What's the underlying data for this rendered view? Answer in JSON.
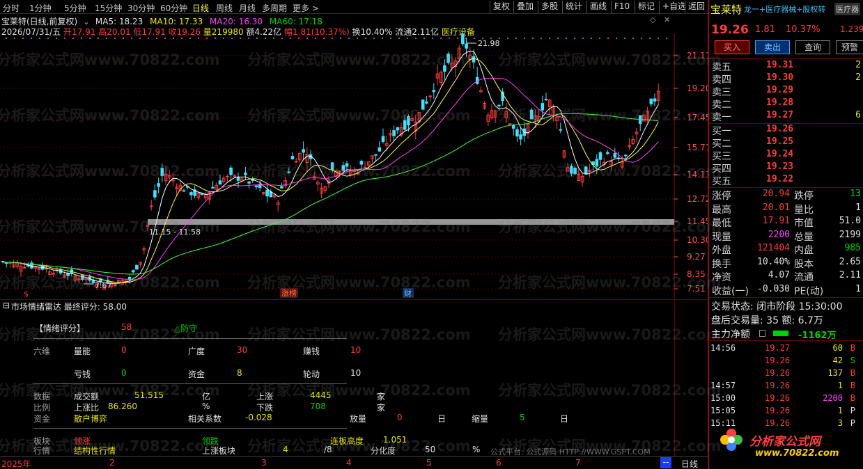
{
  "toolbar": {
    "periods": [
      "分时",
      "1分钟",
      "5分钟",
      "15分钟",
      "30分钟",
      "60分钟",
      "日线",
      "周线",
      "月线",
      "多周期",
      "更多 >"
    ],
    "active_period": "日线",
    "right_buttons": [
      "复权",
      "叠加",
      "多股",
      "统计",
      "画线",
      "F10",
      "标记",
      "+自选",
      "返回"
    ]
  },
  "header": {
    "title": "宝莱特(日线,前复权)",
    "ma5": "MA5: 18.23",
    "ma10": "MA10: 17.33",
    "ma20": "MA20: 16.30",
    "ma60": "MA60: 17.18",
    "date": "2026/07/31/五",
    "open": "开17.91",
    "high": "高20.01",
    "low": "低17.91",
    "close": "收19.26",
    "volume": "量219980",
    "amount": "额4.22亿",
    "amplitude": "幅1.81(10.37%)",
    "turnover": "换10.40%",
    "float": "流通2.11亿",
    "industry": "医疗设备"
  },
  "chart_data": {
    "type": "candlestick",
    "y_ticks": [
      "21.11",
      "19.20",
      "17.45",
      "15.71",
      "14.13",
      "12.72",
      "11.45",
      "10.30",
      "9.27",
      "8.35",
      "7.51"
    ],
    "high_label": "21.98",
    "low_label": "7.67",
    "zone_label": "11.15 - 11.58",
    "event_markers": [
      "$",
      "涨榜",
      "财"
    ],
    "x_ticks": [
      "2025年",
      "2",
      "3",
      "4",
      "5",
      "6",
      "7"
    ],
    "colors": {
      "up": "#ff3c3c",
      "down": "#40e0ff",
      "ma5": "#ffffff",
      "ma10": "#ffff40",
      "ma20": "#ff40ff",
      "ma60": "#40ff40"
    }
  },
  "lower": {
    "title": "市场情绪雷达 最终评分: 58.00",
    "score_label": "【情绪评分】",
    "score_value": "58",
    "mode": "△防守",
    "six_label": "六维",
    "dims": [
      {
        "name": "量能",
        "value": "0"
      },
      {
        "name": "广度",
        "value": "30"
      },
      {
        "name": "赚钱",
        "value": "10"
      },
      {
        "name": "亏钱",
        "value": "0"
      },
      {
        "name": "资金",
        "value": "8"
      },
      {
        "name": "轮动",
        "value": "10"
      }
    ],
    "data_label": "数据",
    "ratio_label": "比例",
    "fund_label": "资金",
    "turnover_label": "成交额",
    "turnover_value": "51.515",
    "turnover_unit": "亿",
    "up_label": "上涨",
    "up_value": "4445",
    "up_unit": "家",
    "up_ratio_label": "上涨比",
    "up_ratio_value": "86.260",
    "up_ratio_unit": "%",
    "down_label": "下跌",
    "down_value": "708",
    "down_unit": "家",
    "fund_type": "散户博弈",
    "corr_label": "相关系数",
    "corr_value": "-0.028",
    "vol_up_label": "放量",
    "vol_up_value": "0",
    "vol_up_unit": "日",
    "vol_down_label": "缩量",
    "vol_down_value": "5",
    "vol_down_unit": "日",
    "sector_label": "板块",
    "sector_lead_up": "领涨",
    "sector_lead_down": "领跌",
    "limit_height_label": "连板高度",
    "limit_height_value": "1.051",
    "market_label": "行情",
    "market_type": "结构性行情",
    "up_sector_label": "上涨板块",
    "up_sector_value": "4",
    "up_sector_total": "/8",
    "diff_label": "分化度",
    "diff_value": "50",
    "diff_unit": "%",
    "platform": "公式平台: 公式源码 HTTP://WWW.GSPT.COM"
  },
  "bottom": {
    "right_label": "日线",
    "dash": "--"
  },
  "quote": {
    "name": "宝莱特",
    "tags": "龙一+医疗器械+股权转",
    "tag_box": "医疗器",
    "price": "19.26",
    "change": "1.81",
    "pct": "10.37%",
    "side_val": "1.239",
    "buttons": [
      "买入",
      "卖出",
      "查询",
      "预警"
    ],
    "asks": [
      {
        "label": "卖五",
        "price": "19.31",
        "vol": "2"
      },
      {
        "label": "卖四",
        "price": "19.30",
        "vol": "2"
      },
      {
        "label": "卖三",
        "price": "19.29",
        "vol": ""
      },
      {
        "label": "卖二",
        "price": "19.28",
        "vol": ""
      },
      {
        "label": "卖一",
        "price": "19.27",
        "vol": "6"
      }
    ],
    "bids": [
      {
        "label": "买一",
        "price": "19.26",
        "vol": ""
      },
      {
        "label": "买二",
        "price": "19.25",
        "vol": ""
      },
      {
        "label": "买三",
        "price": "19.24",
        "vol": ""
      },
      {
        "label": "买四",
        "price": "19.23",
        "vol": ""
      },
      {
        "label": "买五",
        "price": "19.22",
        "vol": ""
      }
    ],
    "stats": [
      {
        "l1": "涨停",
        "v1": "20.94",
        "l2": "跌停",
        "v2": "13"
      },
      {
        "l1": "最高",
        "v1": "20.01",
        "l2": "量比",
        "v2": "1"
      },
      {
        "l1": "最低",
        "v1": "17.91",
        "l2": "市值",
        "v2": "51.0"
      },
      {
        "l1": "现量",
        "v1": "2200",
        "l2": "总量",
        "v2": "2199"
      },
      {
        "l1": "外盘",
        "v1": "121404",
        "l2": "内盘",
        "v2": "985"
      },
      {
        "l1": "换手",
        "v1": "10.40%",
        "l2": "股本",
        "v2": "2.65"
      },
      {
        "l1": "净资",
        "v1": "4.07",
        "l2": "流通",
        "v2": "2.11"
      },
      {
        "l1": "收益(一)",
        "v1": "-0.030",
        "l2": "PE(动)",
        "v2": "1"
      }
    ],
    "status_line": "交易状态: 闭市阶段 15:30:00",
    "after_line": "盘后交易量: 35  额: 6.7万",
    "net_label": "主力净额",
    "net_value": "-1162万",
    "ticks": [
      {
        "time": "14:56",
        "price": "19.27",
        "vol": "60",
        "side": "B"
      },
      {
        "time": "",
        "price": "19.26",
        "vol": "42",
        "side": "S"
      },
      {
        "time": "",
        "price": "19.26",
        "vol": "137",
        "side": "B"
      },
      {
        "time": "14:57",
        "price": "19.26",
        "vol": "1",
        "side": "B"
      },
      {
        "time": "15:00",
        "price": "19.26",
        "vol": "2200",
        "side": "B"
      },
      {
        "time": "15:05",
        "price": "19.26",
        "vol": "1",
        "side": "P"
      },
      {
        "time": "15:11",
        "price": "19.26",
        "vol": "3",
        "side": "P"
      }
    ],
    "logo_text": "分析家公式网",
    "logo_url": "www.70822.com"
  },
  "watermark": "分析家公式网www.70822.com"
}
